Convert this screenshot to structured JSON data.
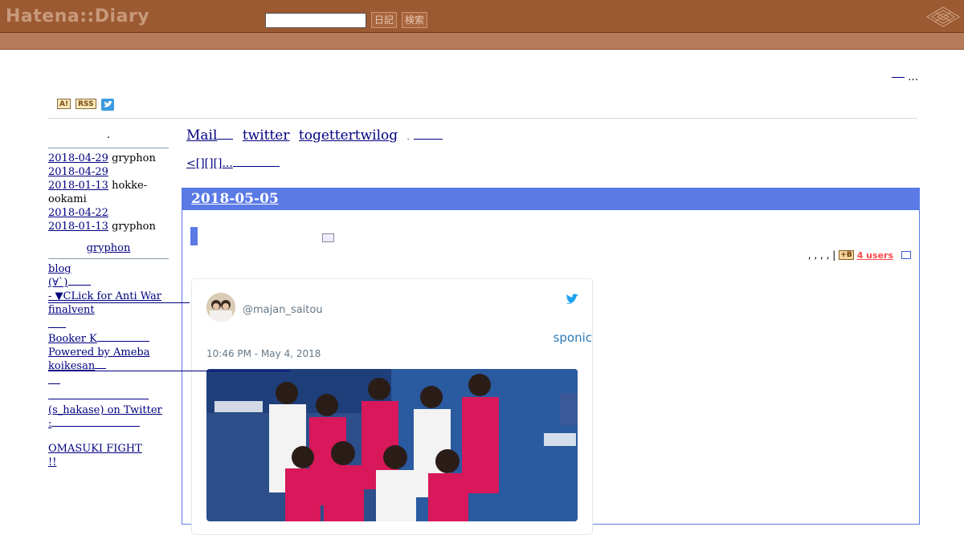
{
  "hatena": {
    "logo": "Hatena::Diary",
    "search_placeholder": "",
    "diary_button": "日記",
    "search_button": "検索"
  },
  "header": {
    "top_right_text": "…"
  },
  "feed_icons": {
    "ai": "A!",
    "rss": "RSS"
  },
  "sidebar": {
    "dot": ".",
    "recent": [
      {
        "date": "2018-04-29",
        "who": "gryphon"
      },
      {
        "date": "2018-04-29",
        "who": ""
      },
      {
        "date": "2018-01-13",
        "who": "hokke-ookami"
      },
      {
        "date": "2018-04-22",
        "who": ""
      },
      {
        "date": "2018-01-13",
        "who": "gryphon"
      }
    ],
    "links_heading": "gryphon",
    "links": [
      "blog",
      "(∀`)",
      " - ▼CLick for Anti War",
      "finalvent",
      "",
      "Booker K",
      "Powered by Ameba",
      "koikesan",
      "",
      "",
      " (s_hakase) on Twitter",
      ":",
      "",
      "OMASUKI FIGHT",
      "  !!"
    ]
  },
  "main_nav": {
    "mail": "Mail",
    "twitter": "twitter",
    "togetter": "togettertwilog",
    "dot": "."
  },
  "prevnext": "<[][][]...",
  "section": {
    "date": "2018-05-05",
    "bookmark_prefix": ", , , ,  |",
    "b_icon": "+B",
    "users": "4 users"
  },
  "tweet": {
    "user": "@majan_saitou",
    "text": "sponic",
    "time": "10:46 PM - May 4, 2018"
  },
  "colors": {
    "hatena_bar": "#9c5a32",
    "section_head": "#5a7ae6",
    "link": "#000080"
  }
}
